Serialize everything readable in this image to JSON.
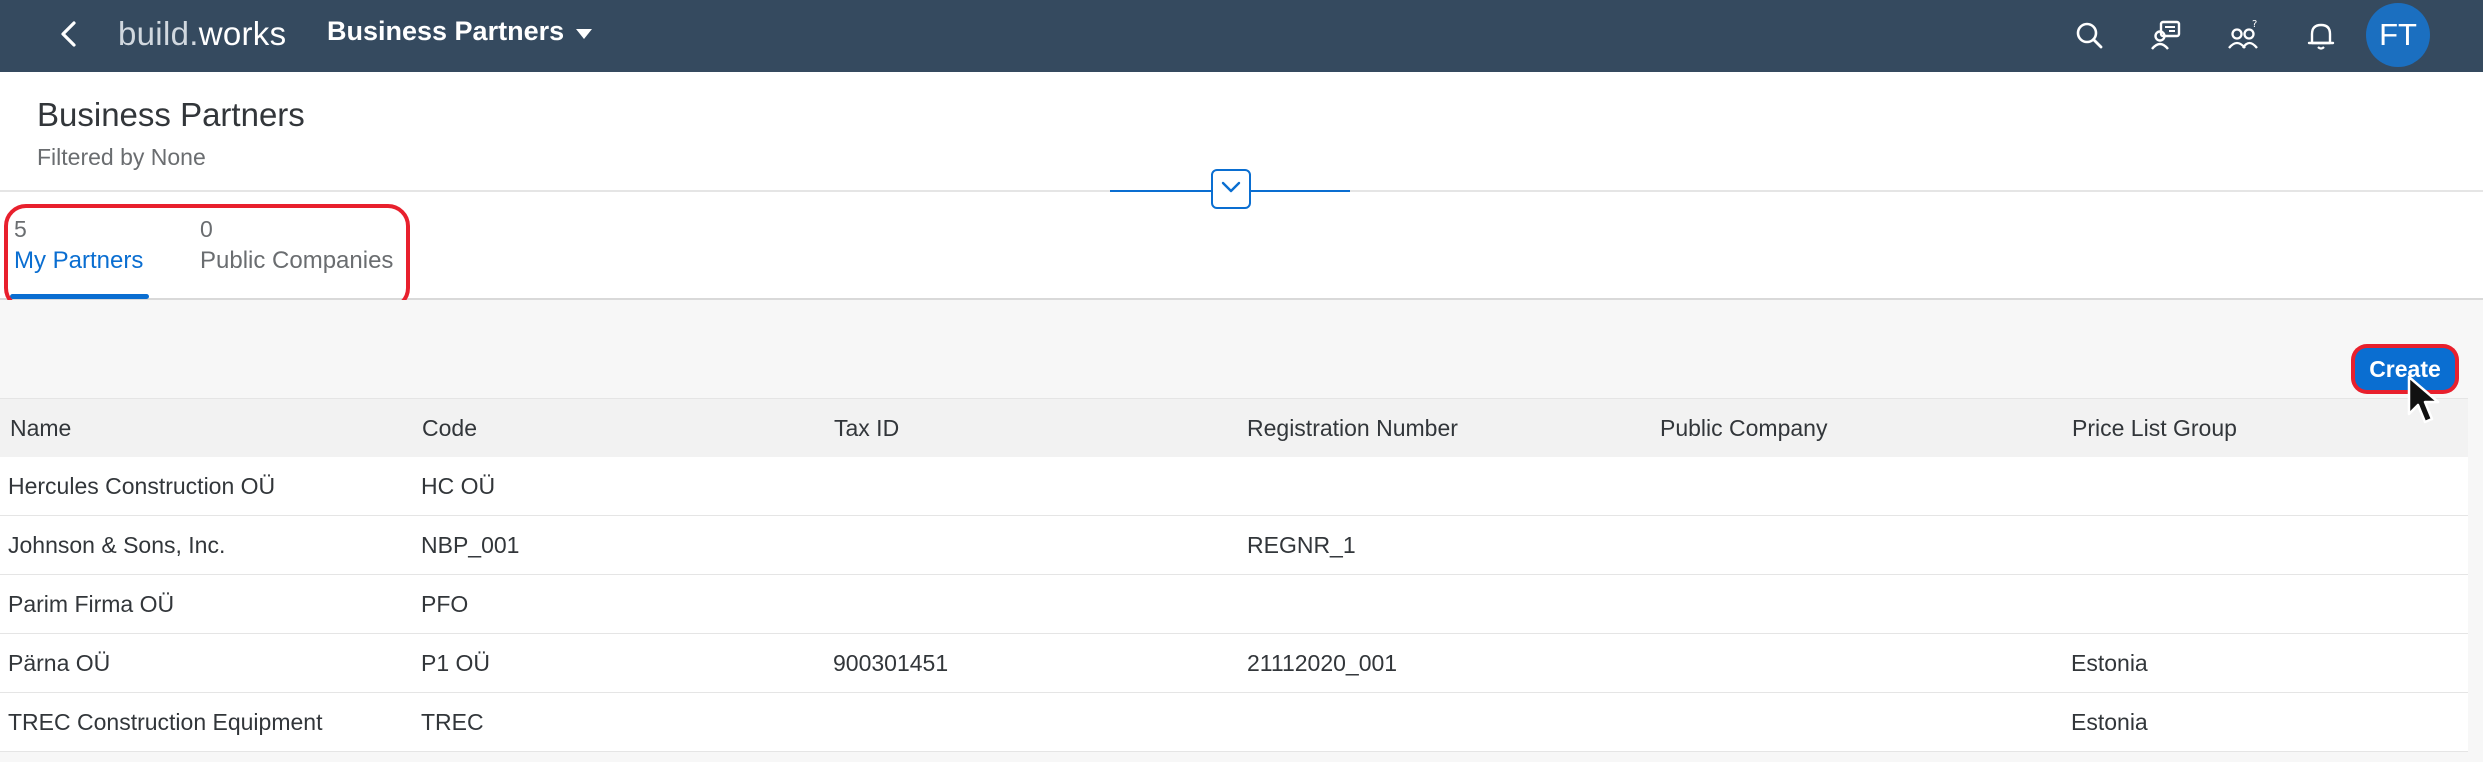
{
  "shell": {
    "logo_prefix": "build.",
    "logo_suffix": "works",
    "app_title": "Business Partners",
    "avatar_initials": "FT",
    "icons": [
      "search-icon",
      "product-switch-icon",
      "people-help-icon",
      "bell-icon"
    ]
  },
  "header": {
    "title": "Business Partners",
    "subtitle": "Filtered by None"
  },
  "tabs": [
    {
      "count": "5",
      "label": "My Partners",
      "active": true
    },
    {
      "count": "0",
      "label": "Public Companies",
      "active": false
    }
  ],
  "toolbar": {
    "create_label": "Create"
  },
  "table": {
    "columns": [
      "Name",
      "Code",
      "Tax ID",
      "Registration Number",
      "Public Company",
      "Price List Group"
    ],
    "rows": [
      [
        "Hercules Construction OÜ",
        "HC OÜ",
        "",
        "",
        "",
        ""
      ],
      [
        "Johnson & Sons, Inc.",
        "NBP_001",
        "",
        "REGNR_1",
        "",
        ""
      ],
      [
        "Parim Firma OÜ",
        "PFO",
        "",
        "",
        "",
        ""
      ],
      [
        "Pärna OÜ",
        "P1 OÜ",
        "900301451",
        "21112020_001",
        "",
        "Estonia"
      ],
      [
        "TREC Construction Equipment",
        "TREC",
        "",
        "",
        "",
        "Estonia"
      ]
    ]
  },
  "colors": {
    "shell_bg": "#354a5f",
    "accent": "#0a6ed1",
    "highlight": "#e8202d",
    "avatar": "#1b6fc0"
  }
}
